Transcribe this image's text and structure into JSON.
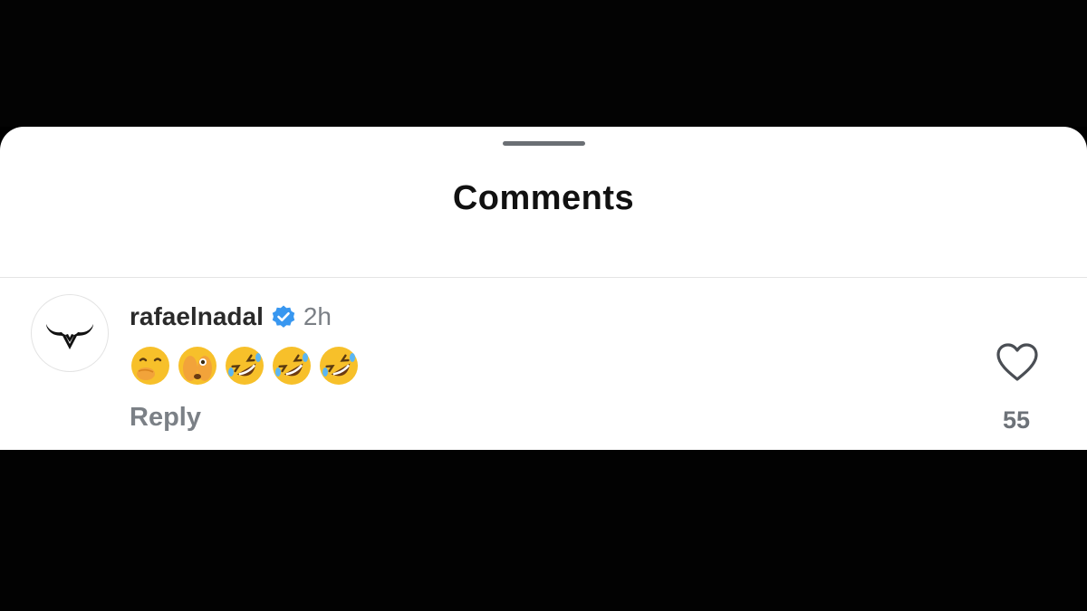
{
  "sheet": {
    "title": "Comments"
  },
  "comment": {
    "username": "rafaelnadal",
    "verified": true,
    "timestamp": "2h",
    "emojis": [
      {
        "name": "face-with-hand-over-mouth",
        "char": "🤭"
      },
      {
        "name": "face-with-peeking-eye",
        "char": "🫣"
      },
      {
        "name": "rolling-on-the-floor-laughing",
        "char": "🤣"
      },
      {
        "name": "rolling-on-the-floor-laughing",
        "char": "🤣"
      },
      {
        "name": "rolling-on-the-floor-laughing",
        "char": "🤣"
      }
    ],
    "reply_label": "Reply",
    "like_count": "55",
    "avatar_icon": "bull-logo-icon",
    "like_icon": "heart-icon"
  },
  "colors": {
    "verified_blue": "#3897f0",
    "emoji_yellow": "#f7c02a"
  }
}
